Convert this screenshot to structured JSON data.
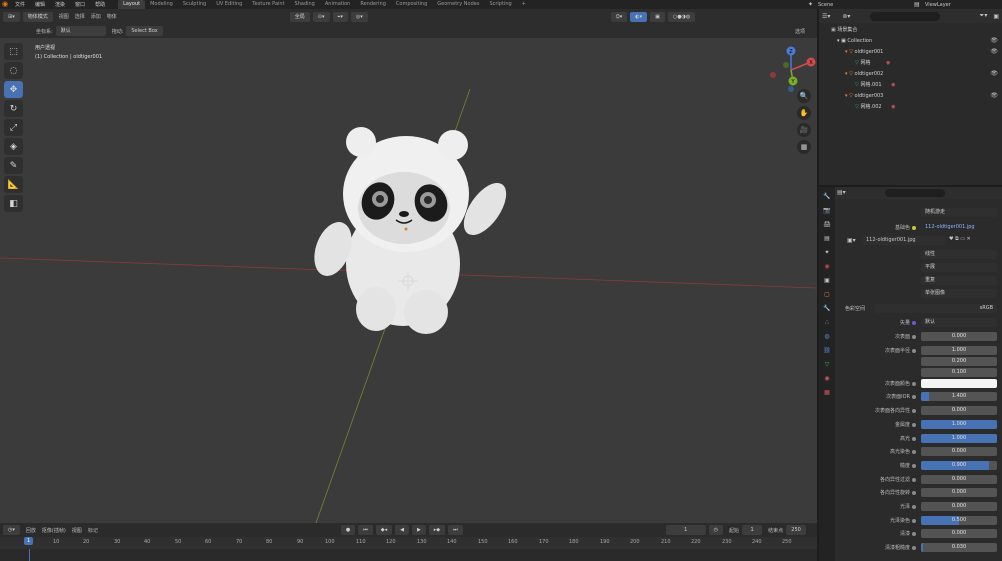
{
  "topbar": {
    "menus": [
      "文件",
      "编辑",
      "渲染",
      "窗口",
      "帮助"
    ],
    "workspaces": [
      "Layout",
      "Modeling",
      "Sculpting",
      "UV Editing",
      "Texture Paint",
      "Shading",
      "Animation",
      "Rendering",
      "Compositing",
      "Geometry Nodes",
      "Scripting",
      "+"
    ],
    "active_workspace": "Layout",
    "scene": "Scene",
    "view_layer": "ViewLayer"
  },
  "viewport": {
    "mode": "物体模式",
    "menus": [
      "视图",
      "选择",
      "添加",
      "物体"
    ],
    "transform_orientation": "全局",
    "options_label": "选项",
    "coord_label": "坐标系:",
    "coord_value": "默认",
    "drag_label": "拖动:",
    "drag_value": "Select Box",
    "view_name": "用户透视",
    "collection_info": "(1) Collection | oldtiger001",
    "gizmo": {
      "x": "X",
      "y": "Y",
      "z": "Z"
    }
  },
  "timeline": {
    "playback": "回放",
    "keying": "抠像(插帧)",
    "view": "视图",
    "marker": "标记",
    "current_frame": "1",
    "start_label": "起始",
    "start": "1",
    "end_label": "结束点",
    "end": "250",
    "ticks": [
      "1",
      "10",
      "20",
      "30",
      "40",
      "50",
      "60",
      "70",
      "80",
      "90",
      "100",
      "110",
      "120",
      "130",
      "140",
      "150",
      "160",
      "170",
      "180",
      "190",
      "200",
      "210",
      "220",
      "230",
      "240",
      "250"
    ]
  },
  "outliner": {
    "root": "场景集合",
    "collection": "Collection",
    "items": [
      {
        "name": "oldtiger001",
        "mesh": "网格"
      },
      {
        "name": "oldtiger002",
        "mesh": "网格.001"
      },
      {
        "name": "oldtiger003",
        "mesh": "网格.002"
      }
    ]
  },
  "properties": {
    "top_dropdown": "随机游走",
    "base_color_label": "基础色",
    "base_color_value": "112-oldtiger001.jpg",
    "image_name": "112-oldtiger001.jpg",
    "image_options": [
      "线性",
      "平展",
      "重复",
      "单张图像"
    ],
    "color_space_label": "色彩空间",
    "color_space_value": "sRGB",
    "vector_label": "矢量",
    "vector_value": "默认",
    "rows": [
      {
        "label": "次表面",
        "value": "0.000",
        "fill": 0
      },
      {
        "label": "次表面半径",
        "value": "1.000",
        "fill": 0
      },
      {
        "label": "",
        "value": "0.200",
        "fill": 0
      },
      {
        "label": "",
        "value": "0.100",
        "fill": 0
      },
      {
        "label": "次表面颜色",
        "value": "",
        "fill": 0
      },
      {
        "label": "次表面IOR",
        "value": "1.400",
        "fill": 0.1
      },
      {
        "label": "次表面各向异性",
        "value": "0.000",
        "fill": 0
      },
      {
        "label": "金属度",
        "value": "1.000",
        "fill": 1
      },
      {
        "label": "高光",
        "value": "1.000",
        "fill": 1
      },
      {
        "label": "高光染色",
        "value": "0.000",
        "fill": 0
      },
      {
        "label": "糙度",
        "value": "0.900",
        "fill": 0.9
      },
      {
        "label": "各向异性过滤",
        "value": "0.000",
        "fill": 0
      },
      {
        "label": "各向异性旋转",
        "value": "0.000",
        "fill": 0
      },
      {
        "label": "光泽",
        "value": "0.000",
        "fill": 0
      },
      {
        "label": "光泽染色",
        "value": "0.500",
        "fill": 0.5
      },
      {
        "label": "清漆",
        "value": "0.000",
        "fill": 0
      },
      {
        "label": "清漆粗糙度",
        "value": "0.030",
        "fill": 0.03
      }
    ]
  },
  "colors": {
    "accent": "#4772b3",
    "active_tool": "#4772b3"
  }
}
